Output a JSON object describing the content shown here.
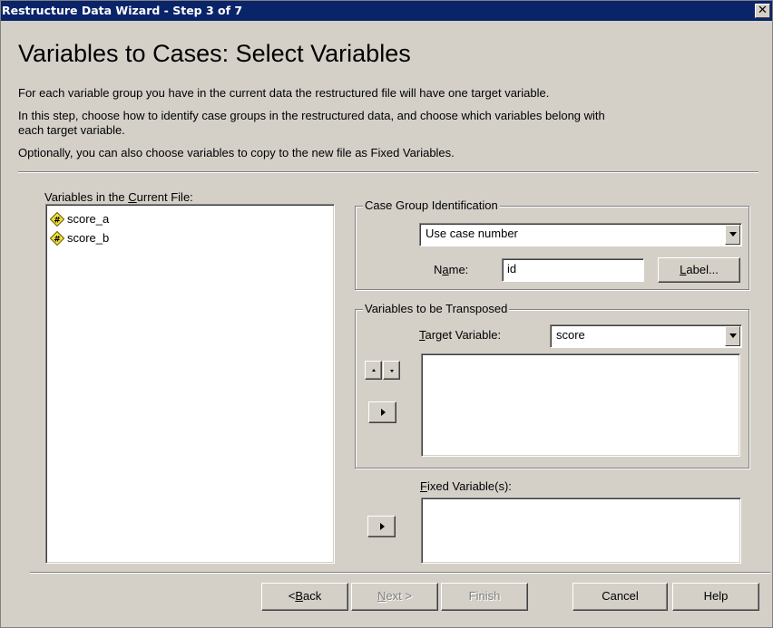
{
  "window": {
    "title": "Restructure Data Wizard - Step 3 of 7",
    "close_glyph": "✕"
  },
  "heading": "Variables to Cases: Select Variables",
  "intro": {
    "line1": "For each variable group you have in the current data the restructured file will have one target variable.",
    "line2a": "In this step, choose how to identify case groups in the restructured data, and choose which variables belong with",
    "line2b": "each target variable.",
    "line3": "Optionally, you can also choose variables to copy to the new file as Fixed Variables."
  },
  "current_vars": {
    "label_pre": "Variables in the ",
    "label_u": "C",
    "label_post": "urrent File:",
    "items": [
      {
        "name": "score_a",
        "icon": "numeric-variable-icon"
      },
      {
        "name": "score_b",
        "icon": "numeric-variable-icon"
      }
    ]
  },
  "case_group": {
    "title": "Case Group Identification",
    "method": "Use case number",
    "name_label_pre": "N",
    "name_label_u": "a",
    "name_label_post": "me:",
    "name_value": "id",
    "label_button_u": "L",
    "label_button_post": "abel..."
  },
  "transpose": {
    "title": "Variables to be Transposed",
    "target_label_u": "T",
    "target_label_post": "arget Variable:",
    "target_value": "score"
  },
  "fixed": {
    "label_u": "F",
    "label_post": "ixed Variable(s):"
  },
  "buttons": {
    "back_pre": "< ",
    "back_u": "B",
    "back_post": "ack",
    "next_u": "N",
    "next_post": "ext >",
    "finish": "Finish",
    "cancel": "Cancel",
    "help": "Help"
  },
  "colors": {
    "titlebar": "#0a246a",
    "face": "#d4d0c8",
    "variable_icon": "#f2e03a"
  }
}
